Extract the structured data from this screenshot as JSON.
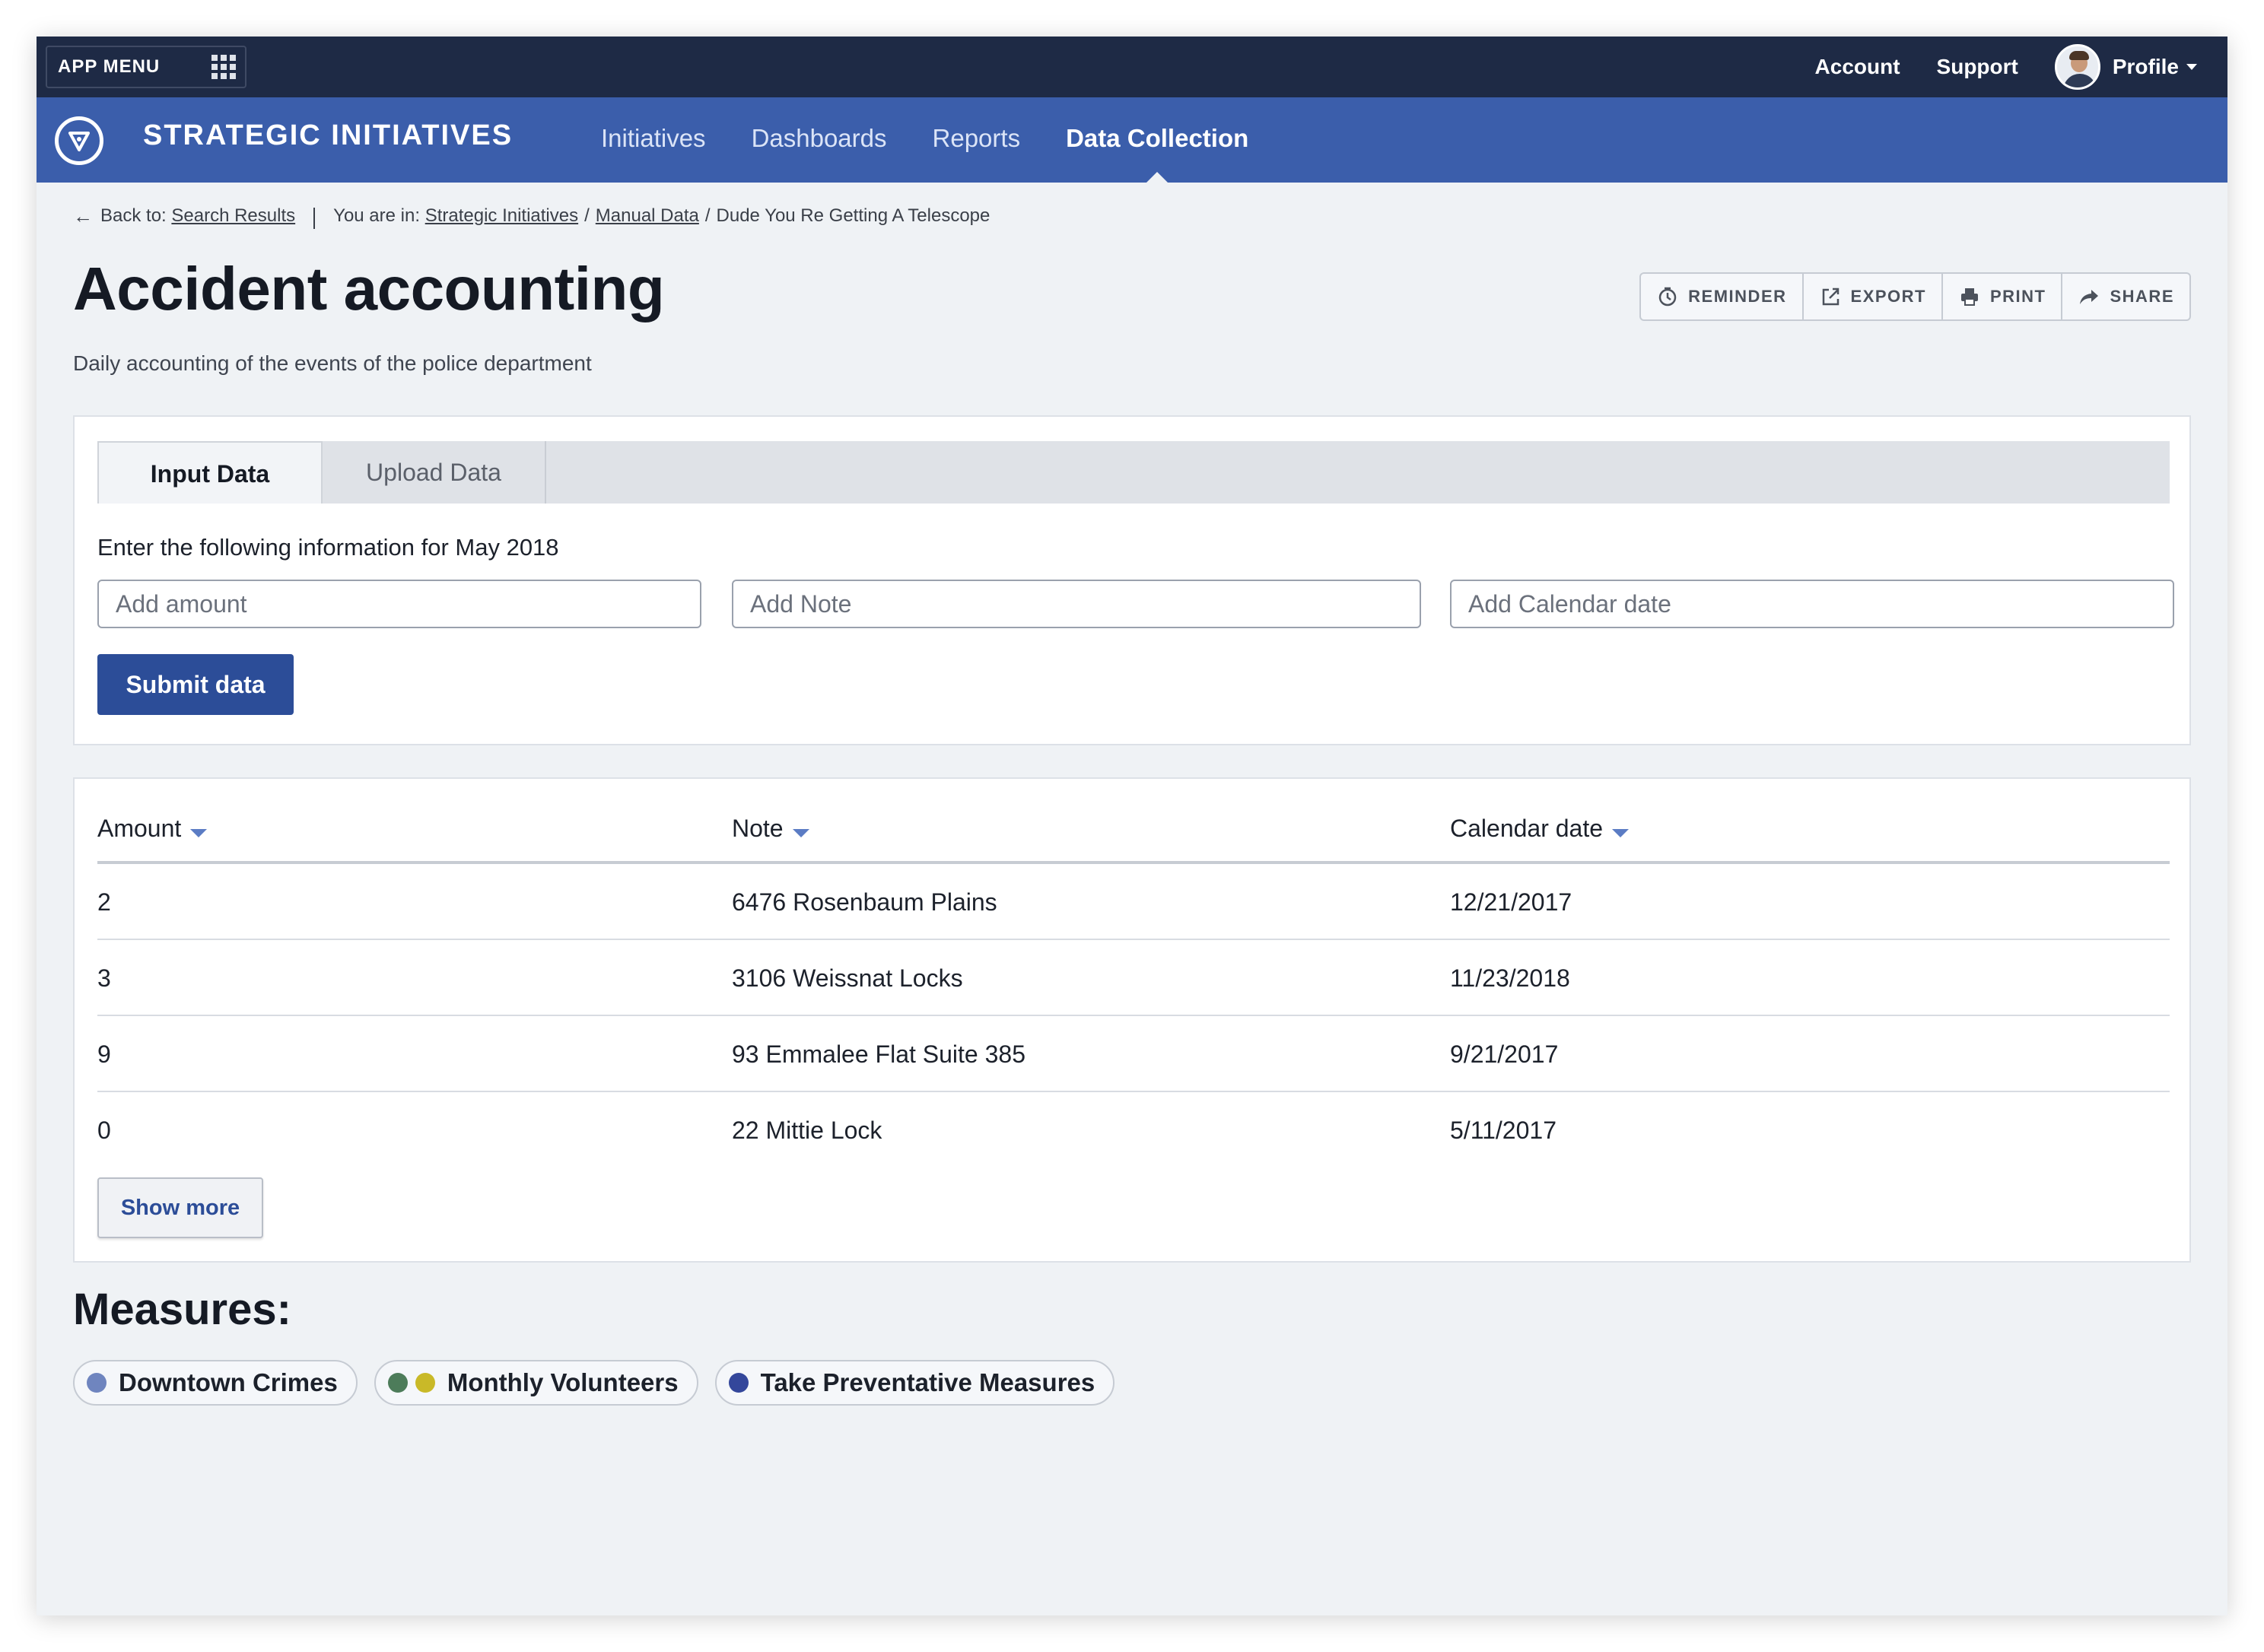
{
  "topbar": {
    "app_menu_label": "APP MENU",
    "links": {
      "account": "Account",
      "support": "Support",
      "profile": "Profile"
    }
  },
  "navbar": {
    "brand": "STRATEGIC INITIATIVES",
    "items": [
      {
        "label": "Initiatives",
        "active": false
      },
      {
        "label": "Dashboards",
        "active": false
      },
      {
        "label": "Reports",
        "active": false
      },
      {
        "label": "Data Collection",
        "active": true
      }
    ],
    "brand_color": "#3b5eab",
    "topbar_color": "#1e2a45"
  },
  "breadcrumb": {
    "back_prefix": "Back to:",
    "back_link": "Search Results",
    "location_prefix": "You are in:",
    "crumbs": [
      "Strategic Initiatives",
      "Manual Data"
    ],
    "current": "Dude You Re Getting A Telescope"
  },
  "page": {
    "title": "Accident accounting",
    "subtitle": "Daily accounting of the events of the police department"
  },
  "actions": {
    "reminder": "REMINDER",
    "export": "EXPORT",
    "print": "PRINT",
    "share": "SHARE"
  },
  "input_card": {
    "tabs": [
      {
        "label": "Input Data",
        "active": true
      },
      {
        "label": "Upload Data",
        "active": false
      }
    ],
    "prompt": "Enter the following information for May 2018",
    "fields": {
      "amount_placeholder": "Add amount",
      "note_placeholder": "Add Note",
      "date_placeholder": "Add Calendar date"
    },
    "submit_label": "Submit data",
    "submit_color": "#2c4d98"
  },
  "table": {
    "headers": [
      "Amount",
      "Note",
      "Calendar date"
    ],
    "rows": [
      [
        "2",
        "6476 Rosenbaum Plains",
        "12/21/2017"
      ],
      [
        "3",
        "3106 Weissnat Locks",
        "11/23/2018"
      ],
      [
        "9",
        "93 Emmalee Flat Suite 385",
        "9/21/2017"
      ],
      [
        "0",
        "22 Mittie Lock",
        "5/11/2017"
      ]
    ],
    "show_more_label": "Show more"
  },
  "measures": {
    "title": "Measures:",
    "chips": [
      {
        "label": "Downtown Crimes",
        "dots": [
          "#6f85bf"
        ]
      },
      {
        "label": "Monthly Volunteers",
        "dots": [
          "#4d7c5a",
          "#c9b928"
        ]
      },
      {
        "label": "Take Preventative Measures",
        "dots": [
          "#34479b"
        ]
      }
    ]
  }
}
